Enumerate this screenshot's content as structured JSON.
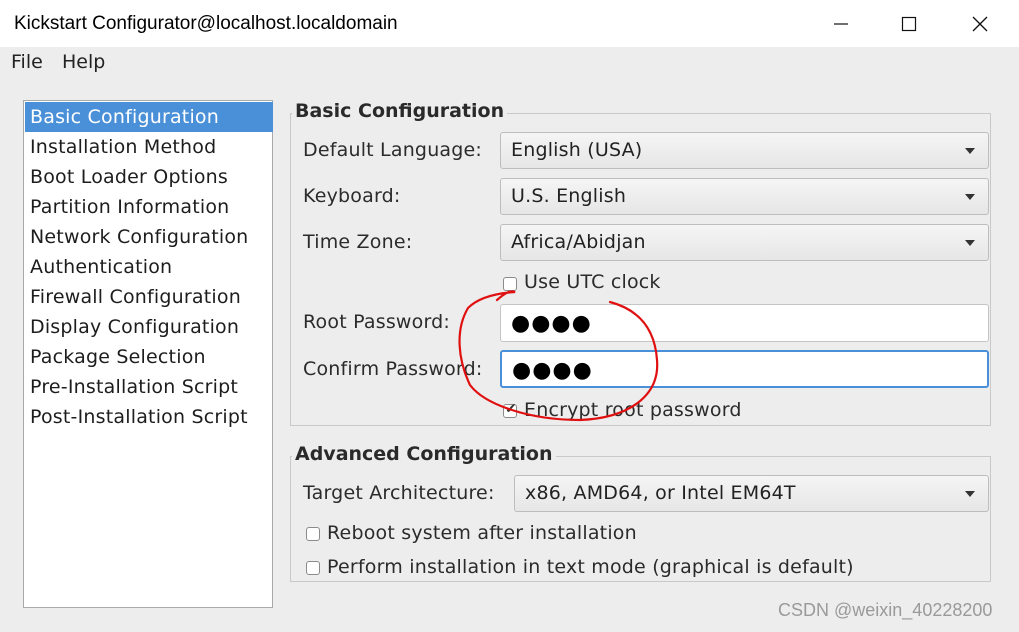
{
  "window": {
    "title": "Kickstart Configurator@localhost.localdomain"
  },
  "menu": {
    "items": [
      {
        "label": "File"
      },
      {
        "label": "Help"
      }
    ]
  },
  "sidebar": {
    "items": [
      {
        "label": "Basic Configuration",
        "selected": true
      },
      {
        "label": "Installation Method"
      },
      {
        "label": "Boot Loader Options"
      },
      {
        "label": "Partition Information"
      },
      {
        "label": "Network Configuration"
      },
      {
        "label": "Authentication"
      },
      {
        "label": "Firewall Configuration"
      },
      {
        "label": "Display Configuration"
      },
      {
        "label": "Package Selection"
      },
      {
        "label": "Pre-Installation Script"
      },
      {
        "label": "Post-Installation Script"
      }
    ]
  },
  "basic": {
    "title": "Basic Configuration",
    "language_label": "Default Language:",
    "language_value": "English (USA)",
    "keyboard_label": "Keyboard:",
    "keyboard_value": "U.S. English",
    "timezone_label": "Time Zone:",
    "timezone_value": "Africa/Abidjan",
    "utc_label": "Use UTC clock",
    "utc_checked": false,
    "root_password_label": "Root Password:",
    "root_password_value": "●●●●",
    "confirm_password_label": "Confirm Password:",
    "confirm_password_value": "●●●●",
    "encrypt_label": "Encrypt root password",
    "encrypt_checked": true
  },
  "advanced": {
    "title": "Advanced Configuration",
    "arch_label": "Target Architecture:",
    "arch_value": "x86, AMD64, or Intel EM64T",
    "reboot_label": "Reboot system after installation",
    "reboot_checked": false,
    "textmode_label": "Perform installation in text mode (graphical is default)",
    "textmode_checked": false
  },
  "watermark": "CSDN @weixin_40228200",
  "colors": {
    "selection": "#4a90d9",
    "annotation": "#e01010",
    "background": "#ededed"
  }
}
